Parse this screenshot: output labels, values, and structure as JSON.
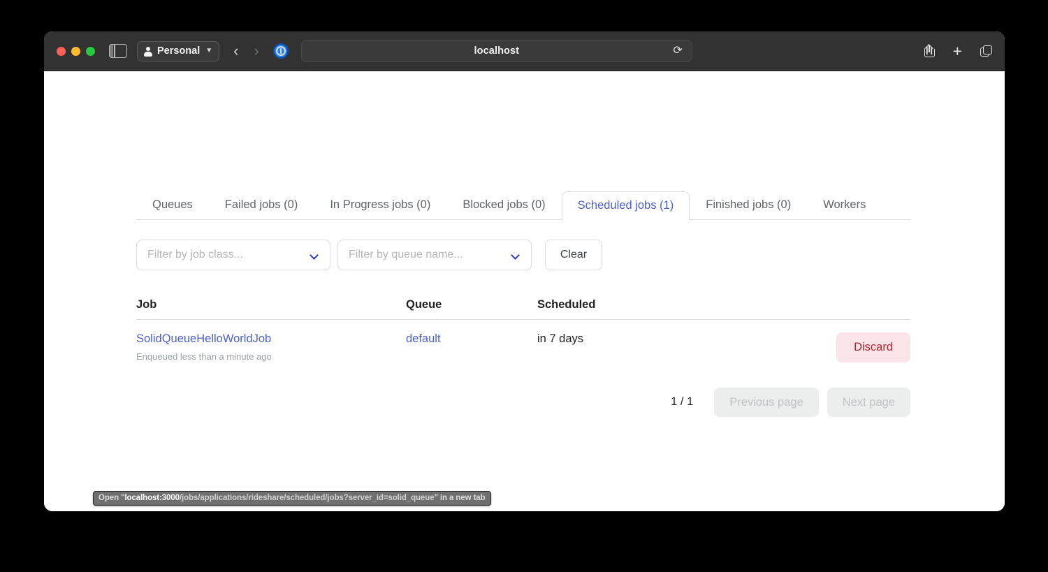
{
  "browser": {
    "profile_label": "Personal",
    "url": "localhost",
    "back_icon": "chevron-left-icon",
    "forward_icon": "chevron-right-icon",
    "reload_icon": "reload-icon",
    "share_icon": "share-icon",
    "new_tab_icon": "plus-icon",
    "tab_overview_icon": "tab-overview-icon",
    "sidebar_icon": "sidebar-toggle-icon",
    "favicon": "solid-queue-favicon",
    "traffic_lights": {
      "close": "#ff5f57",
      "minimize": "#febc2e",
      "zoom": "#28c840"
    }
  },
  "status_bar": {
    "prefix": "Open \"",
    "host": "localhost:3000",
    "path": "/jobs/applications/rideshare/scheduled/jobs?server_id=solid_queue",
    "suffix": "\" in a new tab"
  },
  "tabs": [
    {
      "label": "Queues",
      "active": false
    },
    {
      "label": "Failed jobs (0)",
      "active": false
    },
    {
      "label": "In Progress jobs (0)",
      "active": false
    },
    {
      "label": "Blocked jobs (0)",
      "active": false
    },
    {
      "label": "Scheduled jobs (1)",
      "active": true
    },
    {
      "label": "Finished jobs (0)",
      "active": false
    },
    {
      "label": "Workers",
      "active": false
    }
  ],
  "filters": {
    "job_class_placeholder": "Filter by job class...",
    "queue_name_placeholder": "Filter by queue name...",
    "clear_label": "Clear",
    "chevron_icon": "chevron-down-icon",
    "accent_color": "#2f36c9"
  },
  "table": {
    "headers": {
      "job": "Job",
      "queue": "Queue",
      "scheduled": "Scheduled",
      "actions": ""
    },
    "rows": [
      {
        "job": "SolidQueueHelloWorldJob",
        "job_meta": "Enqueued less than a minute ago",
        "queue": "default",
        "scheduled": "in 7 days",
        "action_label": "Discard"
      }
    ]
  },
  "pagination": {
    "page_indicator": "1 / 1",
    "previous_label": "Previous page",
    "next_label": "Next page"
  },
  "colors": {
    "link": "#4b5fd0",
    "danger_bg": "#fbe4e7",
    "danger_text": "#b3262f",
    "muted": "#9aa0a6"
  }
}
